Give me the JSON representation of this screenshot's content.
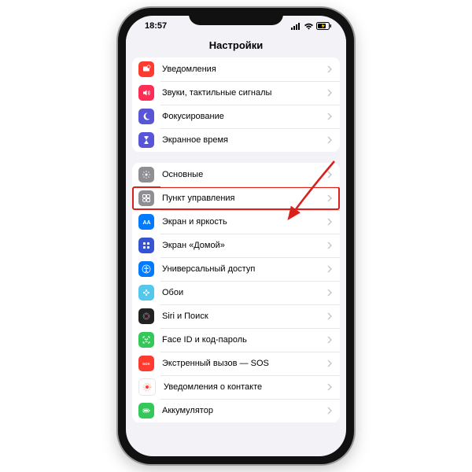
{
  "status": {
    "time": "18:57"
  },
  "header": {
    "title": "Настройки"
  },
  "groups": [
    {
      "rows": [
        {
          "id": "notifications",
          "label": "Уведомления",
          "icon": "notifications-icon",
          "color": "#ff3b30"
        },
        {
          "id": "sounds",
          "label": "Звуки, тактильные сигналы",
          "icon": "sounds-icon",
          "color": "#ff2d55"
        },
        {
          "id": "focus",
          "label": "Фокусирование",
          "icon": "focus-icon",
          "color": "#5856d6"
        },
        {
          "id": "screentime",
          "label": "Экранное время",
          "icon": "screentime-icon",
          "color": "#5856d6"
        }
      ]
    },
    {
      "rows": [
        {
          "id": "general",
          "label": "Основные",
          "icon": "general-icon",
          "color": "#8e8e93"
        },
        {
          "id": "control-center",
          "label": "Пункт управления",
          "icon": "control-center-icon",
          "color": "#8e8e93",
          "highlighted": true
        },
        {
          "id": "display",
          "label": "Экран и яркость",
          "icon": "display-icon",
          "color": "#007aff"
        },
        {
          "id": "home",
          "label": "Экран «Домой»",
          "icon": "home-icon",
          "color": "#3454d1"
        },
        {
          "id": "accessibility",
          "label": "Универсальный доступ",
          "icon": "accessibility-icon",
          "color": "#007aff"
        },
        {
          "id": "wallpaper",
          "label": "Обои",
          "icon": "wallpaper-icon",
          "color": "#54c7ec"
        },
        {
          "id": "siri",
          "label": "Siri и Поиск",
          "icon": "siri-icon",
          "color": "#222"
        },
        {
          "id": "faceid",
          "label": "Face ID и код-пароль",
          "icon": "faceid-icon",
          "color": "#34c759"
        },
        {
          "id": "sos",
          "label": "Экстренный вызов — SOS",
          "icon": "sos-icon",
          "color": "#ff3b30"
        },
        {
          "id": "exposure",
          "label": "Уведомления о контакте",
          "icon": "exposure-icon",
          "color": "#fff"
        },
        {
          "id": "battery",
          "label": "Аккумулятор",
          "icon": "battery-icon",
          "color": "#34c759"
        }
      ]
    }
  ]
}
